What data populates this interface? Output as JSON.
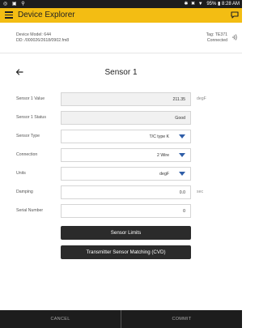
{
  "status_bar": {
    "left_icons": "◎ ▣ ⚲",
    "right_icons": "✱ ✖ ▼",
    "battery": "95%",
    "time": "8:28 AM"
  },
  "app_bar": {
    "title": "Device Explorer",
    "color": "#f3bd13"
  },
  "device": {
    "model": "Device Model: 644",
    "dd": "DD: /000026/2618/0902.fm8",
    "tag": "Tag: TE371",
    "status": "Connected"
  },
  "page": {
    "title": "Sensor 1"
  },
  "fields": [
    {
      "label": "Sensor 1 Value",
      "value": "211.35",
      "unit": "degF"
    },
    {
      "label": "Sensor 1 Status",
      "value": "Good",
      "unit": ""
    },
    {
      "label": "Sensor Type",
      "value": "T/C type K",
      "unit": ""
    },
    {
      "label": "Connection",
      "value": "2 Wire",
      "unit": ""
    },
    {
      "label": "Units",
      "value": "degF",
      "unit": ""
    },
    {
      "label": "Damping",
      "value": "0.0",
      "unit": "sec"
    },
    {
      "label": "Serial Number",
      "value": "0",
      "unit": ""
    }
  ],
  "actions": {
    "sensor_limits": "Sensor Limits",
    "cvd": "Transmitter Sensor Matching (CVD)"
  },
  "bottom_bar": {
    "cancel": "CANCEL",
    "commit": "COMMIT"
  },
  "colors": {
    "accent": "#f3bd13",
    "dropdown_arrow": "#2f5ea8",
    "dark_bar": "#1d1d1d"
  }
}
